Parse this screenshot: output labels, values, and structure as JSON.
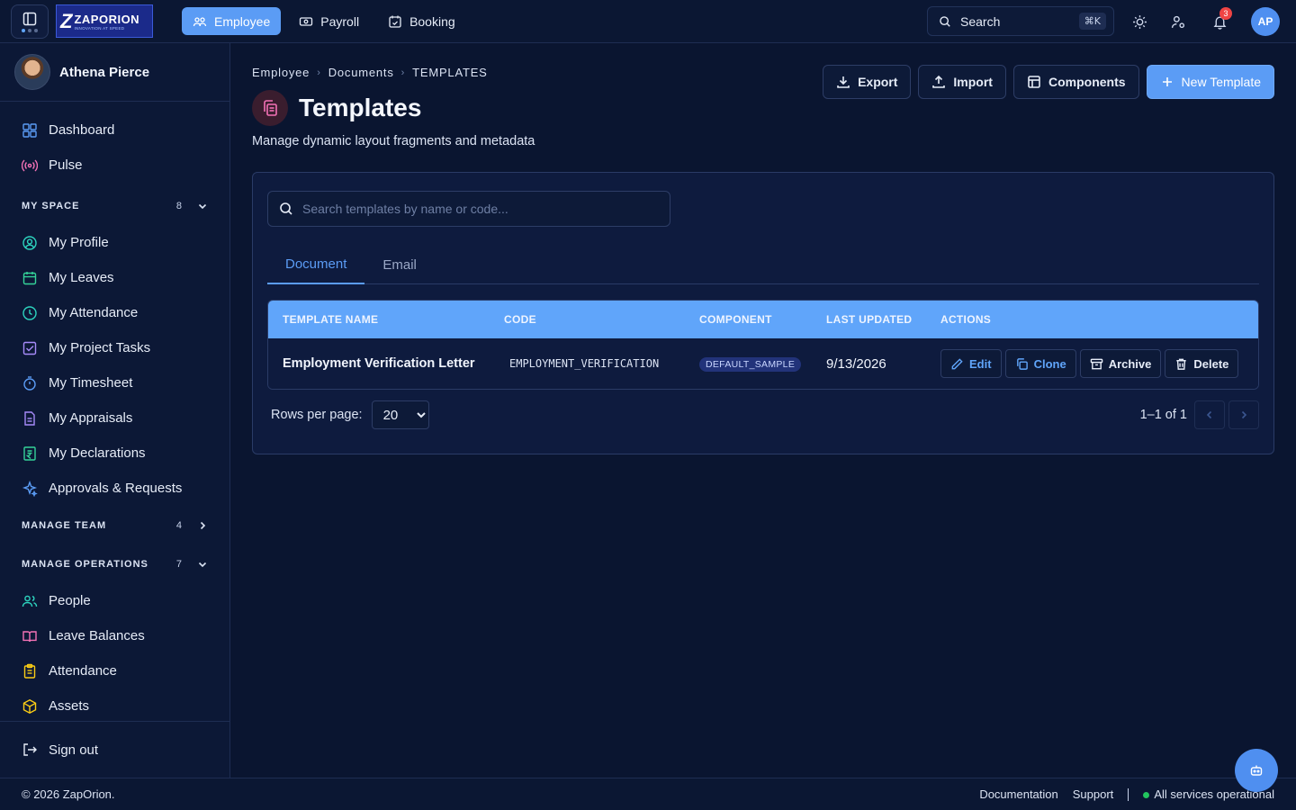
{
  "logo": {
    "brand": "ZAPORION",
    "tagline": "INNOVATION AT SPEED"
  },
  "nav": {
    "tabs": [
      {
        "label": "Employee"
      },
      {
        "label": "Payroll"
      },
      {
        "label": "Booking"
      }
    ]
  },
  "topbar": {
    "search_label": "Search",
    "shortcut": "⌘K",
    "notifications_count": "3",
    "avatar_initials": "AP"
  },
  "user": {
    "name": "Athena Pierce"
  },
  "sidebar": {
    "top_items": [
      {
        "label": "Dashboard"
      },
      {
        "label": "Pulse"
      }
    ],
    "sections": [
      {
        "title": "MY SPACE",
        "count": "8",
        "items": [
          {
            "label": "My Profile"
          },
          {
            "label": "My Leaves"
          },
          {
            "label": "My Attendance"
          },
          {
            "label": "My Project Tasks"
          },
          {
            "label": "My Timesheet"
          },
          {
            "label": "My Appraisals"
          },
          {
            "label": "My Declarations"
          },
          {
            "label": "Approvals & Requests"
          }
        ]
      },
      {
        "title": "MANAGE TEAM",
        "count": "4"
      },
      {
        "title": "MANAGE OPERATIONS",
        "count": "7",
        "items": [
          {
            "label": "People"
          },
          {
            "label": "Leave Balances"
          },
          {
            "label": "Attendance"
          },
          {
            "label": "Assets"
          }
        ]
      }
    ],
    "signout": "Sign out"
  },
  "breadcrumb": [
    "Employee",
    "Documents",
    "TEMPLATES"
  ],
  "page": {
    "title": "Templates",
    "subtitle": "Manage dynamic layout fragments and metadata"
  },
  "actions": {
    "export": "Export",
    "import": "Import",
    "components": "Components",
    "new_template": "New Template"
  },
  "templates": {
    "search_placeholder": "Search templates by name or code...",
    "tabs": [
      {
        "label": "Document"
      },
      {
        "label": "Email"
      }
    ],
    "columns": [
      "TEMPLATE NAME",
      "CODE",
      "COMPONENT",
      "LAST UPDATED",
      "ACTIONS"
    ],
    "rows": [
      {
        "name": "Employment Verification Letter",
        "code": "EMPLOYMENT_VERIFICATION",
        "component": "DEFAULT_SAMPLE",
        "updated": "9/13/2026"
      }
    ],
    "row_actions": {
      "edit": "Edit",
      "clone": "Clone",
      "archive": "Archive",
      "delete": "Delete"
    },
    "pagination": {
      "rows_label": "Rows per page:",
      "rows_value": "20",
      "range": "1–1 of 1"
    }
  },
  "footer": {
    "copyright": "© 2026 ZapOrion.",
    "documentation": "Documentation",
    "support": "Support",
    "status": "All services operational"
  },
  "colors": {
    "accent": "#5b9cf5",
    "table_header": "#60a5fa",
    "background": "#0a1530",
    "danger": "#ef4444",
    "status_ok": "#22c55e"
  }
}
